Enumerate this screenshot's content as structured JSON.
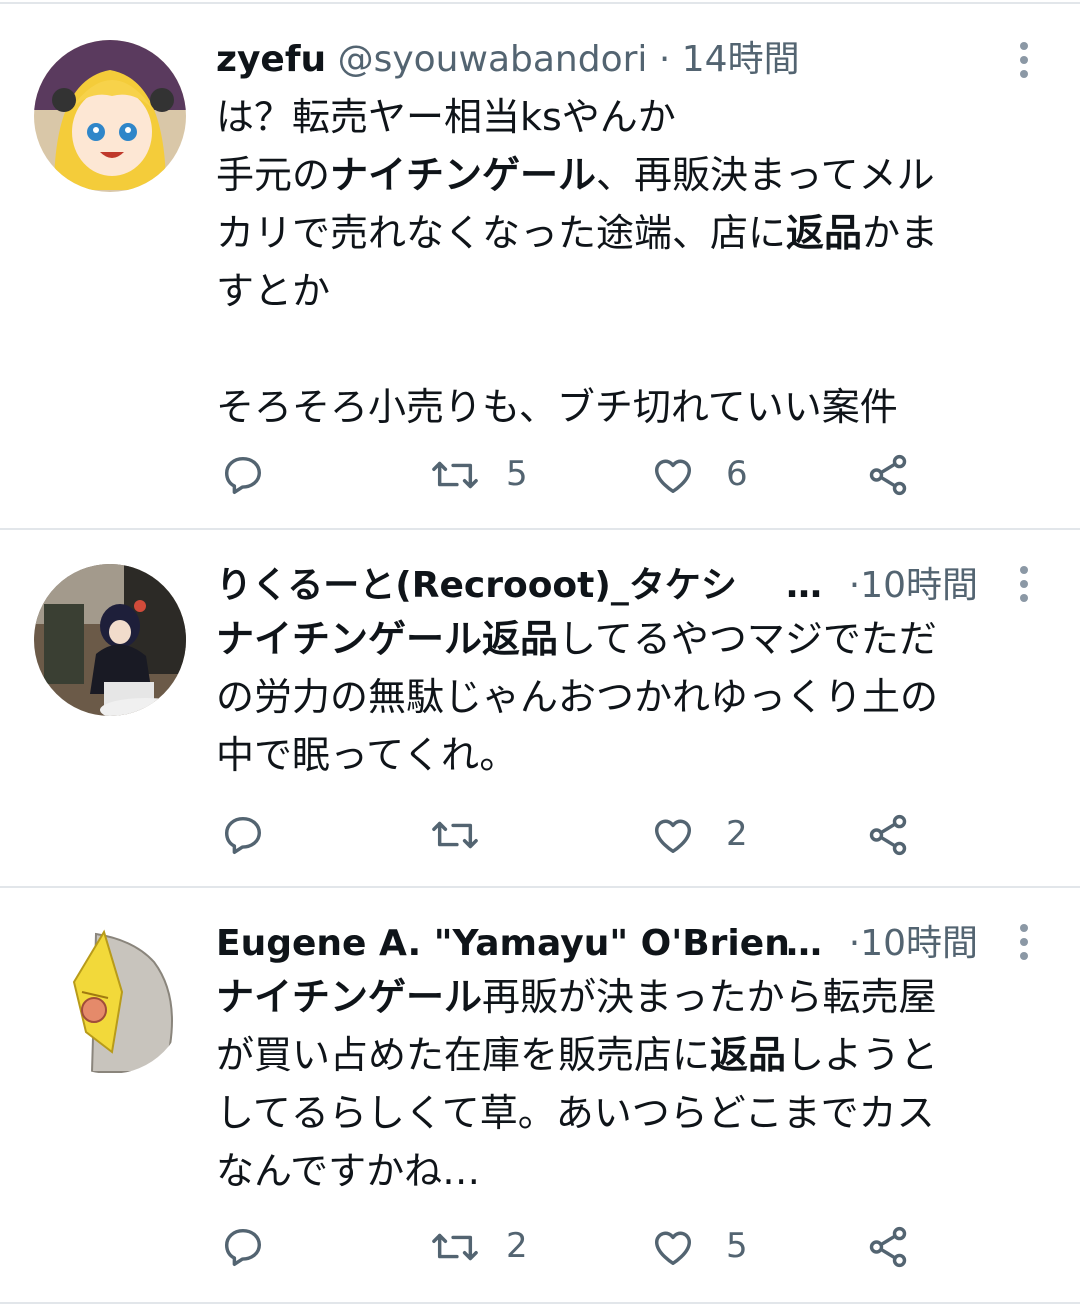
{
  "tweets": [
    {
      "name": "zyefu",
      "handle": "@syouwabandori",
      "dot": "·",
      "time": "14時間",
      "body_lines": [
        [
          {
            "t": "は？転売ヤー相当ksやんか",
            "b": false
          }
        ],
        [
          {
            "t": "手元の",
            "b": false
          },
          {
            "t": "ナイチンゲール",
            "b": true
          },
          {
            "t": "、再販決まってメル",
            "b": false
          }
        ],
        [
          {
            "t": "カリで売れなくなった途端、店に",
            "b": false
          },
          {
            "t": "返品",
            "b": true
          },
          {
            "t": "かま",
            "b": false
          }
        ],
        [
          {
            "t": "すとか",
            "b": false
          }
        ],
        [
          {
            "t": "",
            "b": false
          }
        ],
        [
          {
            "t": "そろそろ小売りも、ブチ切れていい案件",
            "b": false
          }
        ]
      ],
      "retweets": "5",
      "likes": "6"
    },
    {
      "name": "りくるーと(Recrooot)_タケシ",
      "ellipsis": "…",
      "dot": "·",
      "time": "10時間",
      "body_lines": [
        [
          {
            "t": "ナイチンゲール返品",
            "b": true
          },
          {
            "t": "してるやつマジでただ",
            "b": false
          }
        ],
        [
          {
            "t": "の労力の無駄じゃんおつかれゆっくり土の",
            "b": false
          }
        ],
        [
          {
            "t": "中で眠ってくれ。",
            "b": false
          }
        ]
      ],
      "retweets": "",
      "likes": "2"
    },
    {
      "name": "Eugene A. \"Yamayu\" O'Brien",
      "ellipsis": "…",
      "dot": "·",
      "time": "10時間",
      "body_lines": [
        [
          {
            "t": "ナイチンゲール",
            "b": true
          },
          {
            "t": "再販が決まったから転売屋",
            "b": false
          }
        ],
        [
          {
            "t": "が買い占めた在庫を販売店に",
            "b": false
          },
          {
            "t": "返品",
            "b": true
          },
          {
            "t": "しようと",
            "b": false
          }
        ],
        [
          {
            "t": "してるらしくて草。あいつらどこまでカス",
            "b": false
          }
        ],
        [
          {
            "t": "なんですかね…",
            "b": false
          }
        ]
      ],
      "retweets": "2",
      "likes": "5"
    }
  ],
  "icons": [
    "reply-icon",
    "retweet-icon",
    "like-icon",
    "share-icon",
    "more-icon"
  ],
  "colors": {
    "text": "#0f1419",
    "secondary": "#536471",
    "divider": "#e2e6ea"
  }
}
